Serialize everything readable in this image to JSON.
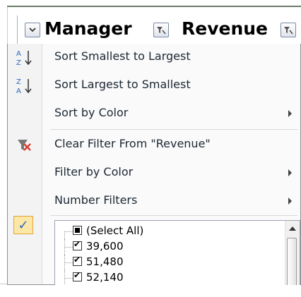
{
  "header": {
    "columns": [
      {
        "label": "Manager",
        "filter_icon": "chevron-down-icon"
      },
      {
        "label": "Revenue",
        "filter_icon": "funnel-icon"
      }
    ]
  },
  "menu": {
    "items": [
      {
        "label": "Sort Smallest to Largest",
        "icon": "sort-ascending-icon",
        "submenu": false
      },
      {
        "label": "Sort Largest to Smallest",
        "icon": "sort-descending-icon",
        "submenu": false
      },
      {
        "label": "Sort by Color",
        "icon": "",
        "submenu": true
      },
      {
        "label": "Clear Filter From \"Revenue\"",
        "icon": "clear-filter-icon",
        "submenu": false
      },
      {
        "label": "Filter by Color",
        "icon": "",
        "submenu": true
      },
      {
        "label": "Number Filters",
        "icon": "",
        "submenu": true
      }
    ],
    "check_icon": "✓"
  },
  "values": {
    "items": [
      {
        "label": "(Select All)",
        "state": "partial"
      },
      {
        "label": "39,600",
        "state": "checked"
      },
      {
        "label": "51,480",
        "state": "checked"
      },
      {
        "label": "52,140",
        "state": "checked"
      }
    ]
  },
  "colors": {
    "accent_blue": "#2a66c4",
    "clear_filter_red": "#d83b2b",
    "check_highlight": "#fde7a6"
  }
}
